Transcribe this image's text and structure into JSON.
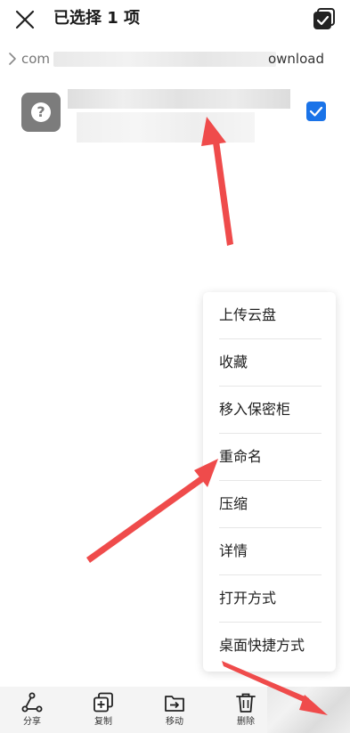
{
  "header": {
    "title": "已选择 1 项"
  },
  "breadcrumb": {
    "start_text": "com",
    "end_text": "ownload"
  },
  "file": {
    "icon_glyph": "?",
    "checked": true
  },
  "context_menu": {
    "items": [
      {
        "label": "上传云盘"
      },
      {
        "label": "收藏"
      },
      {
        "label": "移入保密柜"
      },
      {
        "label": "重命名"
      },
      {
        "label": "压缩"
      },
      {
        "label": "详情"
      },
      {
        "label": "打开方式"
      },
      {
        "label": "桌面快捷方式"
      }
    ]
  },
  "toolbar": {
    "share_label": "分享",
    "copy_label": "复制",
    "move_label": "移动",
    "delete_label": "删除"
  },
  "colors": {
    "accent": "#1a73e8",
    "annotation_arrow": "#ef4b4b",
    "file_icon_bg": "#7c7c7c"
  },
  "icons": {
    "close": "close-icon",
    "select_all": "select-all-icon",
    "chevron": "chevron-right-icon",
    "share": "share-icon",
    "copy": "copy-icon",
    "move": "move-icon",
    "delete": "delete-icon"
  }
}
